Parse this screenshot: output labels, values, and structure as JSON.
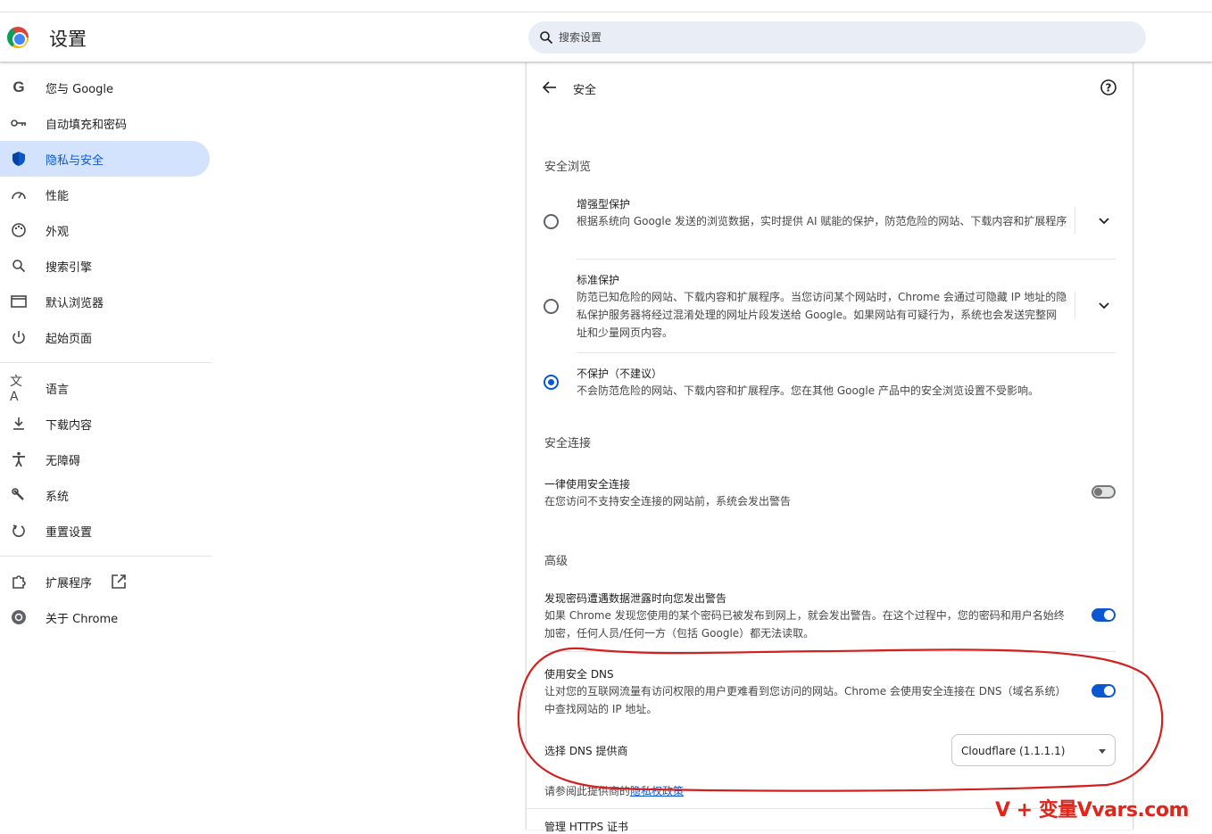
{
  "header": {
    "title": "设置",
    "search_placeholder": "搜索设置"
  },
  "sidebar": {
    "items": [
      {
        "label": "您与 Google",
        "icon": "google-g-icon"
      },
      {
        "label": "自动填充和密码",
        "icon": "key-icon"
      },
      {
        "label": "隐私与安全",
        "icon": "shield-icon",
        "active": true
      },
      {
        "label": "性能",
        "icon": "speedometer-icon"
      },
      {
        "label": "外观",
        "icon": "palette-icon"
      },
      {
        "label": "搜索引擎",
        "icon": "search-icon"
      },
      {
        "label": "默认浏览器",
        "icon": "browser-window-icon"
      },
      {
        "label": "起始页面",
        "icon": "power-icon"
      },
      {
        "label": "语言",
        "icon": "translate-icon"
      },
      {
        "label": "下载内容",
        "icon": "download-icon"
      },
      {
        "label": "无障碍",
        "icon": "accessibility-icon"
      },
      {
        "label": "系统",
        "icon": "wrench-icon"
      },
      {
        "label": "重置设置",
        "icon": "reset-icon"
      },
      {
        "label": "扩展程序",
        "icon": "puzzle-icon"
      },
      {
        "label": "关于 Chrome",
        "icon": "chrome-icon"
      }
    ]
  },
  "page": {
    "title": "安全",
    "safe_browsing": {
      "heading": "安全浏览",
      "options": [
        {
          "title": "增强型保护",
          "desc": "根据系统向 Google 发送的浏览数据，实时提供 AI 赋能的保护，防范危险的网站、下载内容和扩展程序",
          "checked": false
        },
        {
          "title": "标准保护",
          "desc": "防范已知危险的网站、下载内容和扩展程序。当您访问某个网站时，Chrome 会通过可隐藏 IP 地址的隐私保护服务器将经过混淆处理的网址片段发送给 Google。如果网站有可疑行为，系统也会发送完整网址和少量网页内容。",
          "checked": false
        },
        {
          "title": "不保护（不建议）",
          "desc": "不会防范危险的网站、下载内容和扩展程序。您在其他 Google 产品中的安全浏览设置不受影响。",
          "checked": true
        }
      ]
    },
    "secure_connections": {
      "heading": "安全连接",
      "always_https": {
        "title": "一律使用安全连接",
        "desc": "在您访问不支持安全连接的网站前，系统会发出警告",
        "on": false
      }
    },
    "advanced": {
      "heading": "高级",
      "password_leak": {
        "title": "发现密码遭遇数据泄露时向您发出警告",
        "desc": "如果 Chrome 发现您使用的某个密码已被发布到网上，就会发出警告。在这个过程中，您的密码和用户名始终加密，任何人员/任何一方（包括 Google）都无法读取。",
        "on": true
      },
      "secure_dns": {
        "title": "使用安全 DNS",
        "desc": "让对您的互联网流量有访问权限的用户更难看到您访问的网站。Chrome 会使用安全连接在 DNS（域名系统）中查找网站的 IP 地址。",
        "on": true
      },
      "dns_provider": {
        "label": "选择 DNS 提供商",
        "value": "Cloudflare (1.1.1.1)"
      },
      "privacy_note": {
        "prefix": "请参阅此提供商的",
        "link": "隐私权政策"
      },
      "next_item_partial": "管理 HTTPS 证书"
    }
  },
  "watermark": "V + 变量Vvars.com",
  "colors": {
    "accent": "#0b57d0",
    "active_bg": "#d3e3fd",
    "annotation": "#e0251b"
  }
}
